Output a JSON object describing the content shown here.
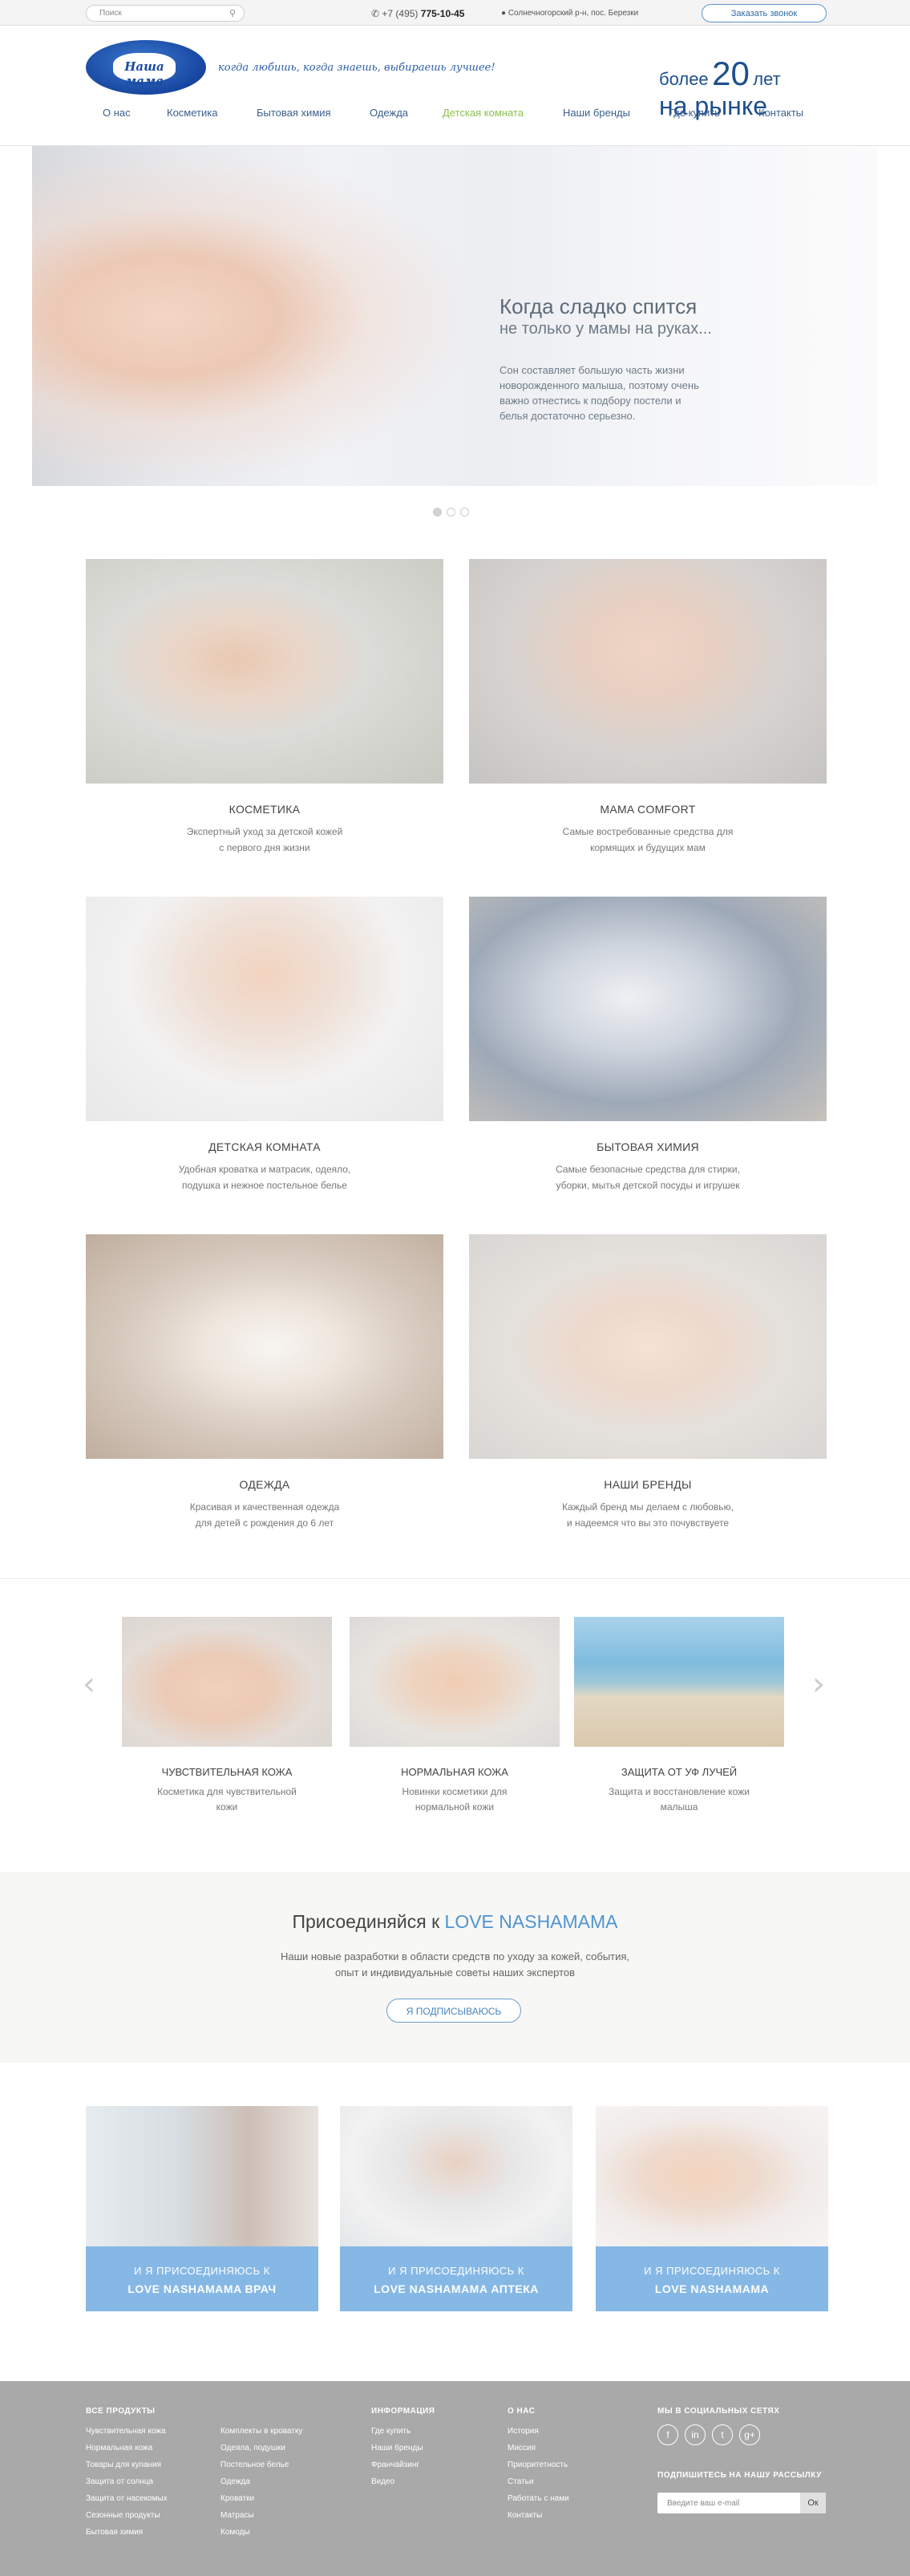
{
  "topbar": {
    "search_placeholder": "Поиск",
    "phone_prefix": "+7 (495) ",
    "phone_number": "775-10-45",
    "address": "Солнечногорский р-н, пос. Березки",
    "call_button": "Заказать звонок"
  },
  "header": {
    "logo_text": "Наша мама",
    "slogan": "когда любишь, когда знаешь, выбираешь лучшее!",
    "years_prefix": "более",
    "years_number": "20",
    "years_unit": "лет",
    "years_line2": "на рынке"
  },
  "nav": [
    {
      "label": "О нас",
      "active": false
    },
    {
      "label": "Косметика",
      "active": false
    },
    {
      "label": "Бытовая химия",
      "active": false
    },
    {
      "label": "Одежда",
      "active": false
    },
    {
      "label": "Детская комната",
      "active": true
    },
    {
      "label": "Наши бренды",
      "active": false
    },
    {
      "label": "Где купить",
      "active": false
    },
    {
      "label": "Контакты",
      "active": false
    }
  ],
  "colors": {
    "active_nav": "#8cc24f",
    "accent": "#4f95cf",
    "band": "#86b8e6"
  },
  "hero": {
    "title": "Когда сладко спится",
    "subtitle": "не только у мамы на руках...",
    "text": "Сон составляет большую часть жизни новорожденного малыша, поэтому очень важно отнестись к подбору постели и белья достаточно серьезно."
  },
  "categories": [
    {
      "title": "КОСМЕТИКА",
      "line1": "Экспертный уход за детской кожей",
      "line2": "с первого дня жизни"
    },
    {
      "title": "MAMA COMFORT",
      "line1": "Самые востребованные средства для",
      "line2": "кормящих и будущих мам"
    },
    {
      "title": "ДЕТСКАЯ КОМНАТА",
      "line1": "Удобная кроватка и матрасик, одеяло,",
      "line2": "подушка и нежное постельное белье"
    },
    {
      "title": "БЫТОВАЯ ХИМИЯ",
      "line1": "Самые безопасные средства для стирки,",
      "line2": "уборки, мытья детской посуды и игрушек"
    },
    {
      "title": "ОДЕЖДА",
      "line1": "Красивая и качественная одежда",
      "line2": "для детей с рождения до 6 лет"
    },
    {
      "title": "НАШИ БРЕНДЫ",
      "line1": "Каждый бренд мы делаем с любовью,",
      "line2": "и надеемся что вы это почувствуете"
    }
  ],
  "carousel": [
    {
      "title": "ЧУВСТВИТЕЛЬНАЯ КОЖА",
      "text": "Косметика для чувствительной кожи"
    },
    {
      "title": "НОРМАЛЬНАЯ КОЖА",
      "text": "Новинки косметики для нормальной кожи"
    },
    {
      "title": "ЗАЩИТА ОТ УФ ЛУЧЕЙ",
      "text": "Защита и восстановление кожи малыша"
    }
  ],
  "join": {
    "title_prefix": "Присоединяйся к ",
    "title_brand": "LOVE NASHAMAMA",
    "line1": "Наши новые разработки в области средств по уходу за кожей, события,",
    "line2": "опыт и индивидуальные советы наших экспертов",
    "button": "Я ПОДПИСЫВАЮСЬ"
  },
  "programs": [
    {
      "line1": "И Я ПРИСОЕДИНЯЮСЬ К",
      "line2": "LOVE NASHAMAMA ВРАЧ"
    },
    {
      "line1": "И Я ПРИСОЕДИНЯЮСЬ К",
      "line2": "LOVE NASHAMAMA АПТЕКА"
    },
    {
      "line1": "И Я ПРИСОЕДИНЯЮСЬ К",
      "line2": "LOVE NASHAMAMA"
    }
  ],
  "footer": {
    "col1_title": "ВСЕ ПРОДУКТЫ",
    "col1": [
      "Чувствительная кожа",
      "Нормальная кожа",
      "Товары для купания",
      "Защита от солнца",
      "Защита от насекомых",
      "Сезонные продукты",
      "Бытовая химия"
    ],
    "col2": [
      "Комплекты в кроватку",
      "Одеяла, подушки",
      "Постельное белье",
      "Одежда",
      "Кроватки",
      "Матрасы",
      "Комоды"
    ],
    "col3_title": "ИНФОРМАЦИЯ",
    "col3": [
      "Где купить",
      "Наши бренды",
      "Франчайзинг",
      "Видео"
    ],
    "col4_title": "О НАС",
    "col4": [
      "История",
      "Миссия",
      "Приоритетность",
      "Статьи",
      "Работать с нами",
      "Контакты"
    ],
    "social_title": "МЫ В СОЦИАЛЬНЫХ СЕТЯХ",
    "social": [
      "f",
      "in",
      "t",
      "g+"
    ],
    "subscribe_title": "ПОДПИШИТЕСЬ НА НАШУ РАССЫЛКУ",
    "email_placeholder": "Введите ваш e-mail",
    "ok": "Ок"
  }
}
